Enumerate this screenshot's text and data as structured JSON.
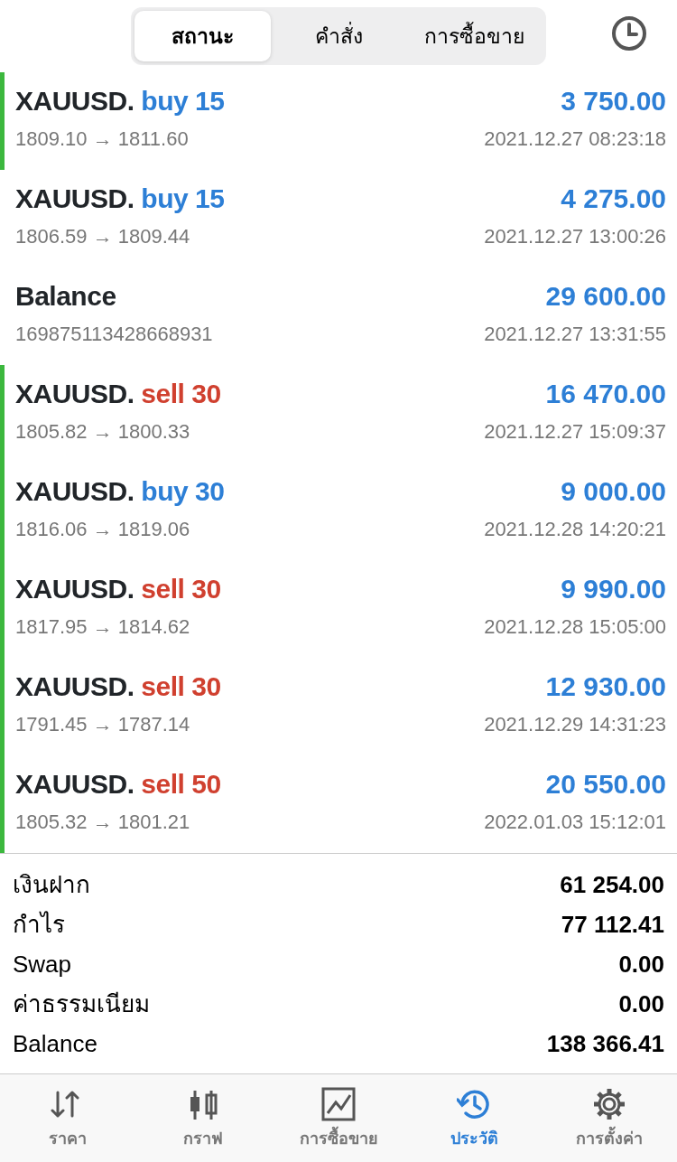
{
  "segments": [
    {
      "label": "สถานะ",
      "selected": true
    },
    {
      "label": "คำสั่ง",
      "selected": false
    },
    {
      "label": "การซื้อขาย",
      "selected": false
    }
  ],
  "deals": [
    {
      "symbol": "XAUUSD.",
      "order": "buy 15",
      "kind": "buy",
      "marked": true,
      "amount": "3 750.00",
      "prices": "1809.10 → 1811.60",
      "time": "2021.12.27 08:23:18"
    },
    {
      "symbol": "XAUUSD.",
      "order": "buy 15",
      "kind": "buy",
      "marked": false,
      "amount": "4 275.00",
      "prices": "1806.59 → 1809.44",
      "time": "2021.12.27 13:00:26"
    },
    {
      "symbol": "Balance",
      "kind": "balance",
      "marked": false,
      "amount": "29 600.00",
      "prices": "169875113428668931",
      "time": "2021.12.27 13:31:55"
    },
    {
      "symbol": "XAUUSD.",
      "order": "sell 30",
      "kind": "sell",
      "marked": true,
      "amount": "16 470.00",
      "prices": "1805.82 → 1800.33",
      "time": "2021.12.27 15:09:37"
    },
    {
      "symbol": "XAUUSD.",
      "order": "buy 30",
      "kind": "buy",
      "marked": true,
      "amount": "9 000.00",
      "prices": "1816.06 → 1819.06",
      "time": "2021.12.28 14:20:21"
    },
    {
      "symbol": "XAUUSD.",
      "order": "sell 30",
      "kind": "sell",
      "marked": true,
      "amount": "9 990.00",
      "prices": "1817.95 → 1814.62",
      "time": "2021.12.28 15:05:00"
    },
    {
      "symbol": "XAUUSD.",
      "order": "sell 30",
      "kind": "sell",
      "marked": true,
      "amount": "12 930.00",
      "prices": "1791.45 → 1787.14",
      "time": "2021.12.29 14:31:23"
    },
    {
      "symbol": "XAUUSD.",
      "order": "sell 50",
      "kind": "sell",
      "marked": true,
      "amount": "20 550.00",
      "prices": "1805.32 → 1801.21",
      "time": "2022.01.03 15:12:01"
    }
  ],
  "summary": [
    {
      "label": "เงินฝาก",
      "value": "61 254.00"
    },
    {
      "label": "กำไร",
      "value": "77 112.41"
    },
    {
      "label": "Swap",
      "value": "0.00"
    },
    {
      "label": "ค่าธรรมเนียม",
      "value": "0.00"
    },
    {
      "label": "Balance",
      "value": "138 366.41"
    }
  ],
  "tabs": [
    {
      "label": "ราคา",
      "kind": "arrows",
      "selected": false
    },
    {
      "label": "กราฟ",
      "kind": "candles",
      "selected": false
    },
    {
      "label": "การซื้อขาย",
      "kind": "chart",
      "selected": false
    },
    {
      "label": "ประวัติ",
      "kind": "history",
      "selected": true
    },
    {
      "label": "การตั้งค่า",
      "kind": "gear",
      "selected": false
    }
  ]
}
